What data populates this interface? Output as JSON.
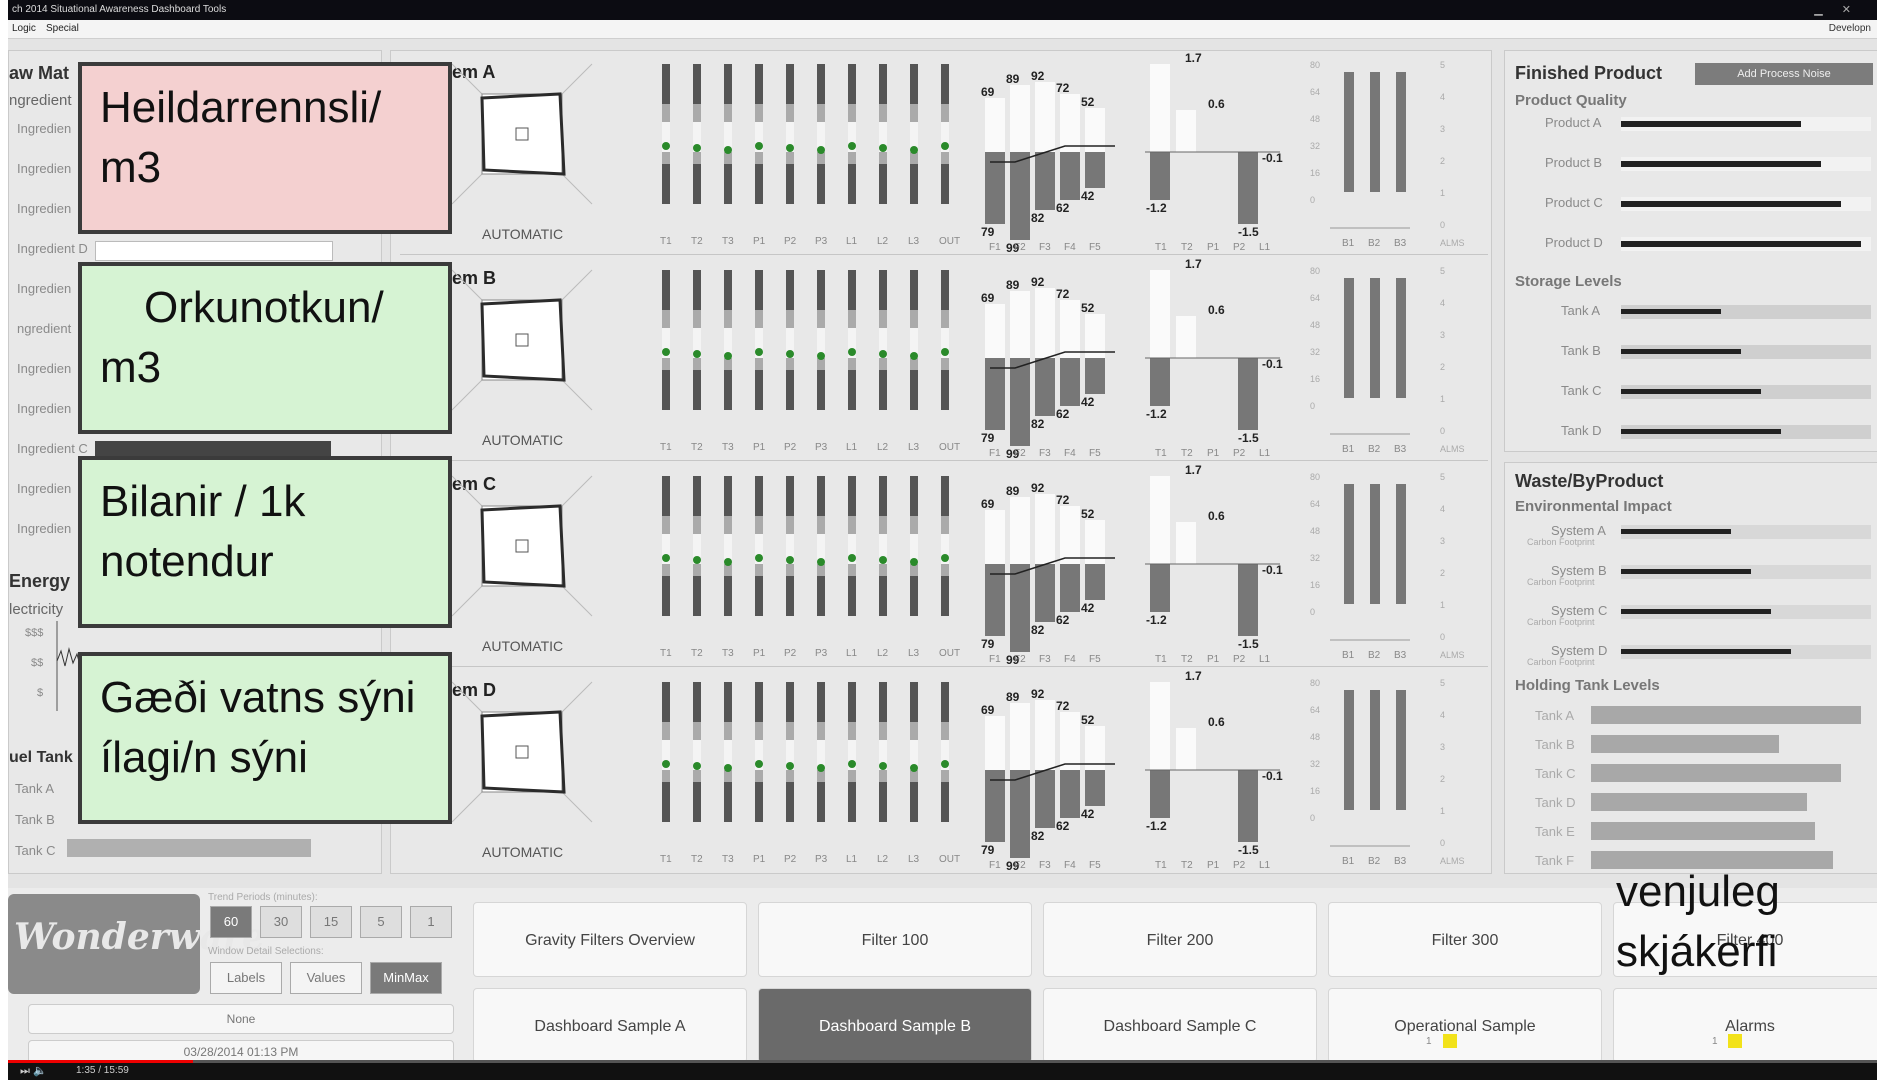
{
  "window": {
    "title": "ch 2014 Situational Awareness Dashboard Tools",
    "right_label": "Developn"
  },
  "menu": [
    "Logic",
    "Special"
  ],
  "left_panel": {
    "title": "aw Mat",
    "sub1": "ngredient",
    "ingredients": [
      "Ingredien",
      "Ingredien",
      "Ingredien",
      "Ingredient D",
      "Ingredien",
      "ngredient",
      "Ingredien",
      "Ingredien",
      "Ingredient C",
      "Ingredien",
      "Ingredien"
    ],
    "energy_title": "Energy",
    "electricity": "lectricity",
    "y_ticks": [
      "$$$",
      "$$",
      "$"
    ],
    "fuel_title": "uel Tank",
    "fuel_tanks": [
      "Tank A",
      "Tank B",
      "Tank C"
    ]
  },
  "overlays": [
    {
      "text_line1": "Heildarrennsli/",
      "text_line2": "m3",
      "color": "#f4d0d0"
    },
    {
      "text_line1": "Orkunotkun/",
      "text_line2": "m3",
      "color": "#d6f3d3"
    },
    {
      "text_line1": "Bilanir / 1k",
      "text_line2": "notendur",
      "color": "#d6f3d3"
    },
    {
      "text_line1": "Gæði vatns sýni",
      "text_line2": "ílagi/n sýni",
      "color": "#d6f3d3"
    }
  ],
  "systems": [
    {
      "name": "em A",
      "mode": "AUTOMATIC"
    },
    {
      "name": "em B",
      "mode": "AUTOMATIC"
    },
    {
      "name": "em C",
      "mode": "AUTOMATIC"
    },
    {
      "name": "em D",
      "mode": "AUTOMATIC"
    }
  ],
  "trend_labels": [
    "T1",
    "T2",
    "T3",
    "P1",
    "P2",
    "P3",
    "L1",
    "L2",
    "L3",
    "OUT"
  ],
  "flow_labels": [
    "F1",
    "F2",
    "F3",
    "F4",
    "F5"
  ],
  "flow_top_values": [
    "69",
    "89",
    "92",
    "72",
    "52"
  ],
  "flow_bottom_values": [
    "79",
    "99",
    "82",
    "62",
    "42"
  ],
  "tp_labels": [
    "T1",
    "T2",
    "P1",
    "P2",
    "L1"
  ],
  "tp_values": {
    "a": "1.7",
    "b": "0.6",
    "c": "-0.1",
    "d": "-1.2",
    "e": "-1.5"
  },
  "scale_left": [
    "80",
    "64",
    "48",
    "32",
    "16",
    "0"
  ],
  "b_labels": [
    "B1",
    "B2",
    "B3"
  ],
  "alm_scale": [
    "5",
    "4",
    "3",
    "2",
    "1",
    "0"
  ],
  "alm_label": "ALMS",
  "finished": {
    "title": "Finished Product",
    "noise_button": "Add Process Noise",
    "quality_title": "Product Quality",
    "products": [
      "Product A",
      "Product B",
      "Product C",
      "Product D"
    ],
    "storage_title": "Storage Levels",
    "tanks": [
      "Tank A",
      "Tank B",
      "Tank C",
      "Tank D"
    ]
  },
  "waste": {
    "title": "Waste/ByProduct",
    "env_title": "Environmental Impact",
    "systems": [
      "System A",
      "System B",
      "System C",
      "System D"
    ],
    "sub": "Carbon Footprint",
    "holding_title": "Holding Tank Levels",
    "holding": [
      "Tank A",
      "Tank B",
      "Tank C",
      "Tank D",
      "Tank E",
      "Tank F"
    ]
  },
  "bottom": {
    "logo": "Wonderware",
    "trend_label": "Trend Periods (minutes):",
    "periods": [
      "60",
      "30",
      "15",
      "5",
      "1"
    ],
    "detail_label": "Window Detail Selections:",
    "details": [
      "Labels",
      "Values",
      "MinMax"
    ],
    "none_field": "None",
    "date_field": "03/28/2014 01:13 PM",
    "nav_row1": [
      "Gravity Filters Overview",
      "Filter 100",
      "Filter 200",
      "Filter 300",
      "Filter 400"
    ],
    "nav_row2": [
      "Dashboard Sample A",
      "Dashboard Sample B",
      "Dashboard Sample C",
      "Operational Sample",
      "Alarms"
    ],
    "op_count": "1",
    "alarm_count": "1"
  },
  "annotation": {
    "line1": "venjuleg",
    "line2": "skjákerfi"
  },
  "player": {
    "time": "1:35 / 15:59"
  }
}
